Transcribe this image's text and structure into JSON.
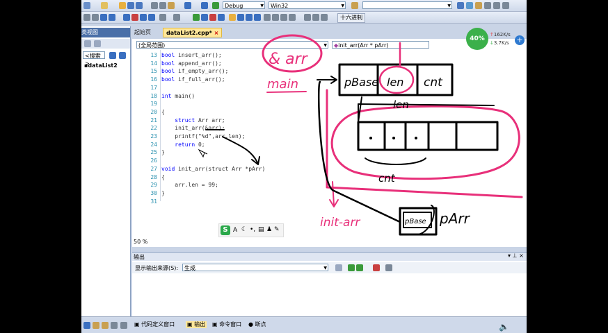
{
  "toolbar": {
    "config": "Debug",
    "platform": "Win32",
    "hex_button": "十六进制"
  },
  "tabs": [
    {
      "label": "起始页"
    },
    {
      "label": "dataList2.cpp*"
    }
  ],
  "left_pane": {
    "title": "类视图",
    "search_label": "<搜索>",
    "tree_item": "dataList2"
  },
  "scope_left": "(全局范围)",
  "scope_right": "init_arr(Arr * pArr)",
  "code_lines": [
    {
      "num": "13",
      "kw": "bool",
      "rest": " insert_arr();"
    },
    {
      "num": "14",
      "kw": "bool",
      "rest": " append_arr();"
    },
    {
      "num": "15",
      "kw": "bool",
      "rest": " if_empty_arr();"
    },
    {
      "num": "16",
      "kw": "bool",
      "rest": " if_full_arr();"
    },
    {
      "num": "17",
      "kw": "",
      "rest": ""
    },
    {
      "num": "18",
      "kw": "int",
      "rest": " main()"
    },
    {
      "num": "19",
      "kw": "",
      "rest": ""
    },
    {
      "num": "20",
      "kw": "",
      "rest": "{"
    },
    {
      "num": "21",
      "kw": "struct",
      "rest": " Arr arr;"
    },
    {
      "num": "22",
      "kw": "",
      "rest": "init_arr(&arr);"
    },
    {
      "num": "23",
      "kw": "",
      "rest": "printf(\"%d\",arr.len);"
    },
    {
      "num": "24",
      "kw": "return",
      "rest": " 0;"
    },
    {
      "num": "25",
      "kw": "",
      "rest": "}"
    },
    {
      "num": "26",
      "kw": "",
      "rest": ""
    },
    {
      "num": "27",
      "kw": "void",
      "rest": " init_arr(struct Arr *pArr)"
    },
    {
      "num": "28",
      "kw": "",
      "rest": "{"
    },
    {
      "num": "29",
      "kw": "",
      "rest": "arr.len = 99;"
    },
    {
      "num": "30",
      "kw": "",
      "rest": "}"
    },
    {
      "num": "31",
      "kw": "",
      "rest": ""
    }
  ],
  "zoom": "50 %",
  "output": {
    "title": "输出",
    "source_label": "显示输出来源(S):",
    "source_value": "生成"
  },
  "status_tabs": [
    {
      "label": "代码定义窗口"
    },
    {
      "label": "输出"
    },
    {
      "label": "命令窗口"
    },
    {
      "label": "断点"
    }
  ],
  "net_widget": {
    "percent": "40%",
    "up": "162K/s",
    "down": "3.7K/s"
  },
  "annotations": {
    "ampersand_arr": "& arr",
    "main": "main",
    "pbase": "pBase",
    "len": "len",
    "cnt": "cnt",
    "len2": "len",
    "cnt2": "cnt",
    "init_arr": "init-arr",
    "pbase2": "pBase",
    "parr": "pArr"
  },
  "colors": {
    "ink_black": "#000000",
    "ink_pink": "#e8307a",
    "keyword_blue": "#0000ff",
    "line_number": "#2b91af"
  }
}
